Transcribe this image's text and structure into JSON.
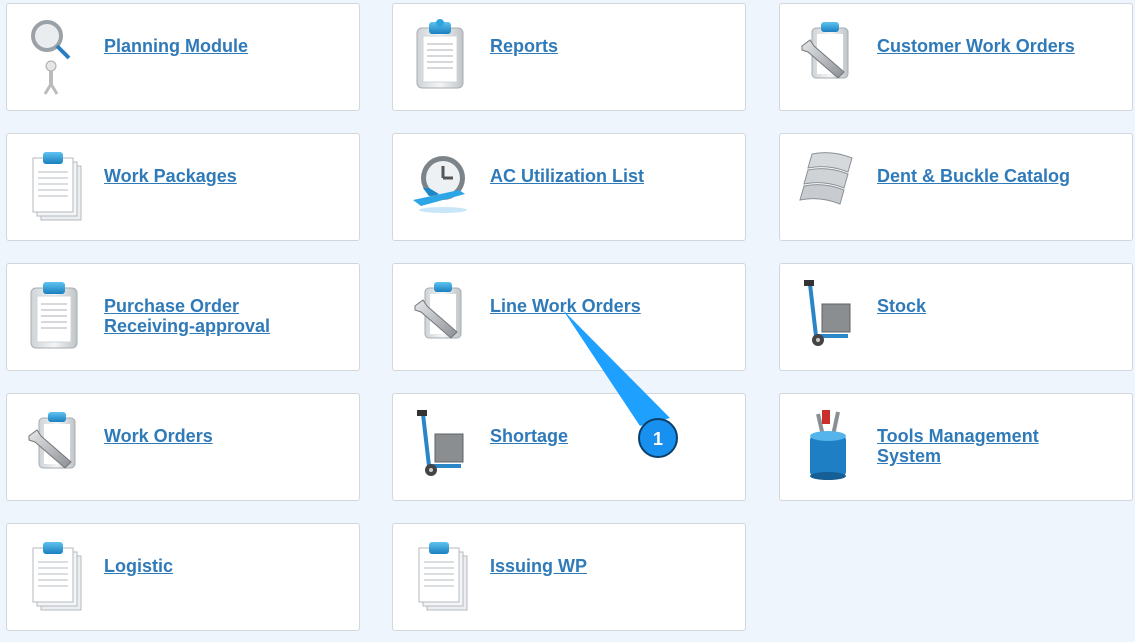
{
  "tiles": {
    "planning": {
      "label": "Planning Module"
    },
    "reports": {
      "label": "Reports"
    },
    "customer_wo": {
      "label": "Customer Work Orders"
    },
    "work_packages": {
      "label": "Work Packages"
    },
    "ac_utilization": {
      "label": "AC Utilization List"
    },
    "dent_buckle": {
      "label": "Dent & Buckle Catalog"
    },
    "purchase_order": {
      "label_line1": "Purchase Order",
      "label_line2": "Receiving-approval"
    },
    "line_wo": {
      "label": "Line Work Orders"
    },
    "stock": {
      "label": "Stock"
    },
    "work_orders": {
      "label": "Work Orders"
    },
    "shortage": {
      "label": "Shortage"
    },
    "tools": {
      "label_line1": "Tools Management",
      "label_line2": "System"
    },
    "logistic": {
      "label": "Logistic"
    },
    "issuing_wp": {
      "label": "Issuing WP"
    }
  },
  "callout": {
    "number": "1"
  },
  "colors": {
    "link": "#2f7ab9",
    "callout": "#1ea0ff",
    "background": "#eef5fc"
  }
}
